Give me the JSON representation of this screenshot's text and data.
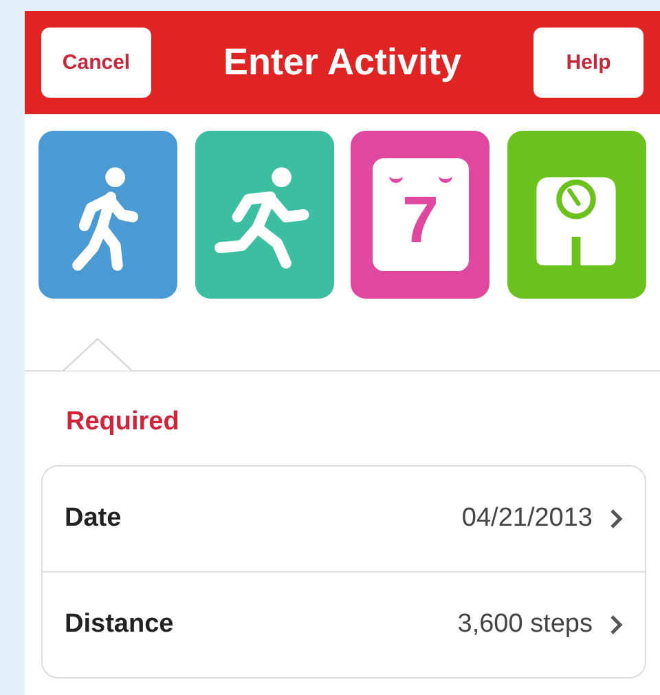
{
  "header": {
    "title": "Enter Activity",
    "left_button": "Cancel",
    "right_button": "Help"
  },
  "activities": [
    {
      "kind": "walk",
      "color": "#4a9bd4",
      "selected": true
    },
    {
      "kind": "run",
      "color": "#3cbfa0",
      "selected": false
    },
    {
      "kind": "calendar",
      "color": "#e0479e",
      "day": "7",
      "selected": false
    },
    {
      "kind": "scale",
      "color": "#6cc21c",
      "selected": false
    }
  ],
  "section": {
    "title": "Required"
  },
  "fields": [
    {
      "label": "Date",
      "value": "04/21/2013"
    },
    {
      "label": "Distance",
      "value": "3,600 steps"
    }
  ]
}
